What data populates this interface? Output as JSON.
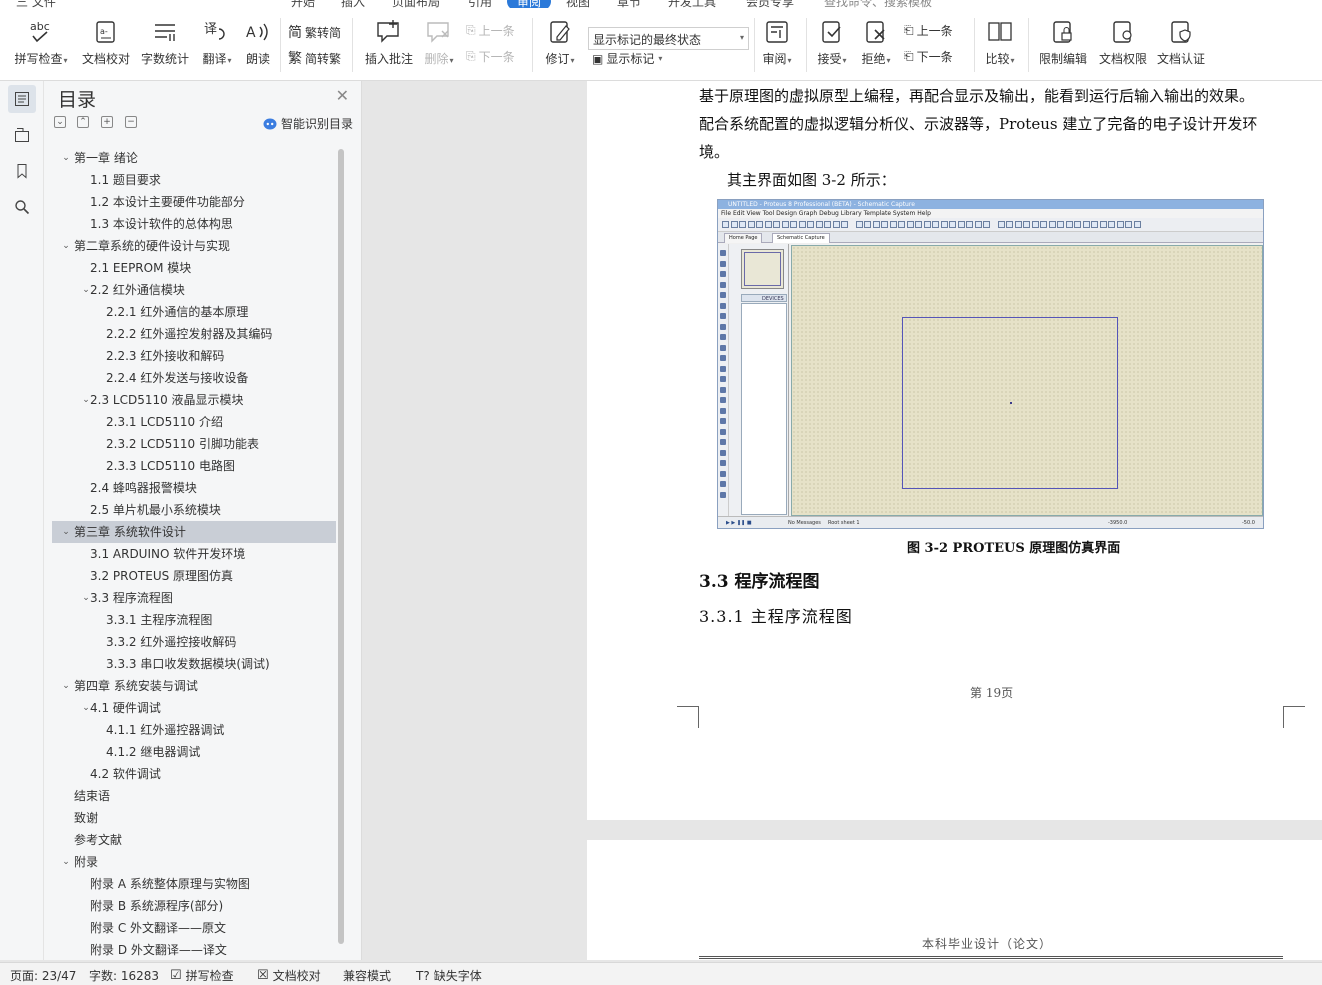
{
  "menu": {
    "file": "三 文件",
    "tabs": [
      "开始",
      "插入",
      "页面布局",
      "引用",
      "审阅",
      "视图",
      "章节",
      "开发工具",
      "会员专享"
    ],
    "search": "查找命令、搜索模板",
    "active_tab": "审阅",
    "accent": "#2b79d9"
  },
  "ribbon": {
    "spell_check": "拼写检查",
    "doc_proof": "文档校对",
    "word_count": "字数统计",
    "translate": "翻译",
    "read_aloud": "朗读",
    "trad": "繁转简",
    "simp": "简转繁",
    "insert_comment": "插入批注",
    "delete": "删除",
    "prev_comment": "上一条",
    "next_comment": "下一条",
    "revise": "修订",
    "markup_state": "显示标记的最终状态",
    "show_markup": "显示标记",
    "review": "审阅",
    "accept": "接受",
    "reject": "拒绝",
    "prev_change": "上一条",
    "next_change": "下一条",
    "compare": "比较",
    "restrict_edit": "限制编辑",
    "doc_rights": "文档权限",
    "doc_auth": "文档认证"
  },
  "toc": {
    "title": "目录",
    "smart": "智能识别目录",
    "items": [
      {
        "text": "第一章  绪论",
        "level": 0,
        "toggle": "v"
      },
      {
        "text": "1.1    题目要求",
        "level": 1,
        "toggle": ""
      },
      {
        "text": "1.2    本设计主要硬件功能部分",
        "level": 1,
        "toggle": ""
      },
      {
        "text": "1.3    本设计软件的总体构思",
        "level": 1,
        "toggle": ""
      },
      {
        "text": "第二章系统的硬件设计与实现",
        "level": 0,
        "toggle": "v"
      },
      {
        "text": "2.1    EEPROM 模块",
        "level": 1,
        "toggle": ""
      },
      {
        "text": "2.2    红外通信模块",
        "level": 1,
        "toggle": "v"
      },
      {
        "text": "2.2.1    红外通信的基本原理",
        "level": 2,
        "toggle": ""
      },
      {
        "text": "2.2.2    红外遥控发射器及其编码",
        "level": 2,
        "toggle": ""
      },
      {
        "text": "2.2.3    红外接收和解码",
        "level": 2,
        "toggle": ""
      },
      {
        "text": "2.2.4    红外发送与接收设备",
        "level": 2,
        "toggle": ""
      },
      {
        "text": "2.3    LCD5110 液晶显示模块",
        "level": 1,
        "toggle": "v"
      },
      {
        "text": "2.3.1    LCD5110 介绍",
        "level": 2,
        "toggle": ""
      },
      {
        "text": "2.3.2    LCD5110 引脚功能表",
        "level": 2,
        "toggle": ""
      },
      {
        "text": "2.3.3    LCD5110 电路图",
        "level": 2,
        "toggle": ""
      },
      {
        "text": "2.4     蜂鸣器报警模块",
        "level": 1,
        "toggle": ""
      },
      {
        "text": "2.5    单片机最小系统模块",
        "level": 1,
        "toggle": ""
      },
      {
        "text": "第三章  系统软件设计",
        "level": 0,
        "toggle": "v",
        "selected": true
      },
      {
        "text": "3.1    ARDUINO 软件开发环境",
        "level": 1,
        "toggle": ""
      },
      {
        "text": "3.2    PROTEUS 原理图仿真",
        "level": 1,
        "toggle": ""
      },
      {
        "text": "3.3    程序流程图",
        "level": 1,
        "toggle": "v"
      },
      {
        "text": "3.3.1    主程序流程图",
        "level": 2,
        "toggle": ""
      },
      {
        "text": "3.3.2    红外遥控接收解码",
        "level": 2,
        "toggle": ""
      },
      {
        "text": "3.3.3    串口收发数据模块(调试)",
        "level": 2,
        "toggle": ""
      },
      {
        "text": "第四章  系统安装与调试",
        "level": 0,
        "toggle": "v"
      },
      {
        "text": "4.1  硬件调试",
        "level": 1,
        "toggle": "v"
      },
      {
        "text": "4.1.1 红外遥控器调试",
        "level": 2,
        "toggle": ""
      },
      {
        "text": "4.1.2 继电器调试",
        "level": 2,
        "toggle": ""
      },
      {
        "text": "4.2  软件调试",
        "level": 1,
        "toggle": ""
      },
      {
        "text": "结束语",
        "level": 0,
        "toggle": ""
      },
      {
        "text": "致谢",
        "level": 0,
        "toggle": ""
      },
      {
        "text": "参考文献",
        "level": 0,
        "toggle": ""
      },
      {
        "text": "附录",
        "level": 0,
        "toggle": "v"
      },
      {
        "text": "附录 A    系统整体原理与实物图",
        "level": 1,
        "toggle": ""
      },
      {
        "text": "附录 B    系统源程序(部分)",
        "level": 1,
        "toggle": ""
      },
      {
        "text": "附录 C    外文翻译——原文",
        "level": 1,
        "toggle": ""
      },
      {
        "text": "附录 D    外文翻译——译文",
        "level": 1,
        "toggle": ""
      }
    ]
  },
  "document": {
    "line1": "基于原理图的虚拟原型上编程，再配合显示及输出，能看到运行后输入输出的效果。",
    "line2": "配合系统配置的虚拟逻辑分析仪、示波器等，Proteus 建立了完备的电子设计开发环",
    "line3": "境。",
    "line4": "其主界面如图 3-2 所示：",
    "caption": "图 3-2 PROTEUS 原理图仿真界面",
    "h2": "3.3  程序流程图",
    "h3": "3.3.1  主程序流程图",
    "page_number": "第 19页",
    "next_header": "本科毕业设计（论文）"
  },
  "figure": {
    "title": "UNTITLED - Proteus 8 Professional (BETA) - Schematic Capture",
    "menus": "File  Edit  View  Tool  Design  Graph  Debug  Library  Template  System  Help",
    "tab_home": "Home Page",
    "tab_schematic": "Schematic Capture",
    "devices": "DEVICES",
    "status_msg": "No Messages",
    "status_sheet": "Root sheet 1",
    "status_coord1": "-3950.0",
    "status_coord2": "-50.0"
  },
  "status": {
    "page": "页面: 23/47",
    "words": "字数: 16283",
    "spell": "拼写检查",
    "proof": "文档校对",
    "compat": "兼容模式",
    "missing_font": "缺失字体"
  }
}
